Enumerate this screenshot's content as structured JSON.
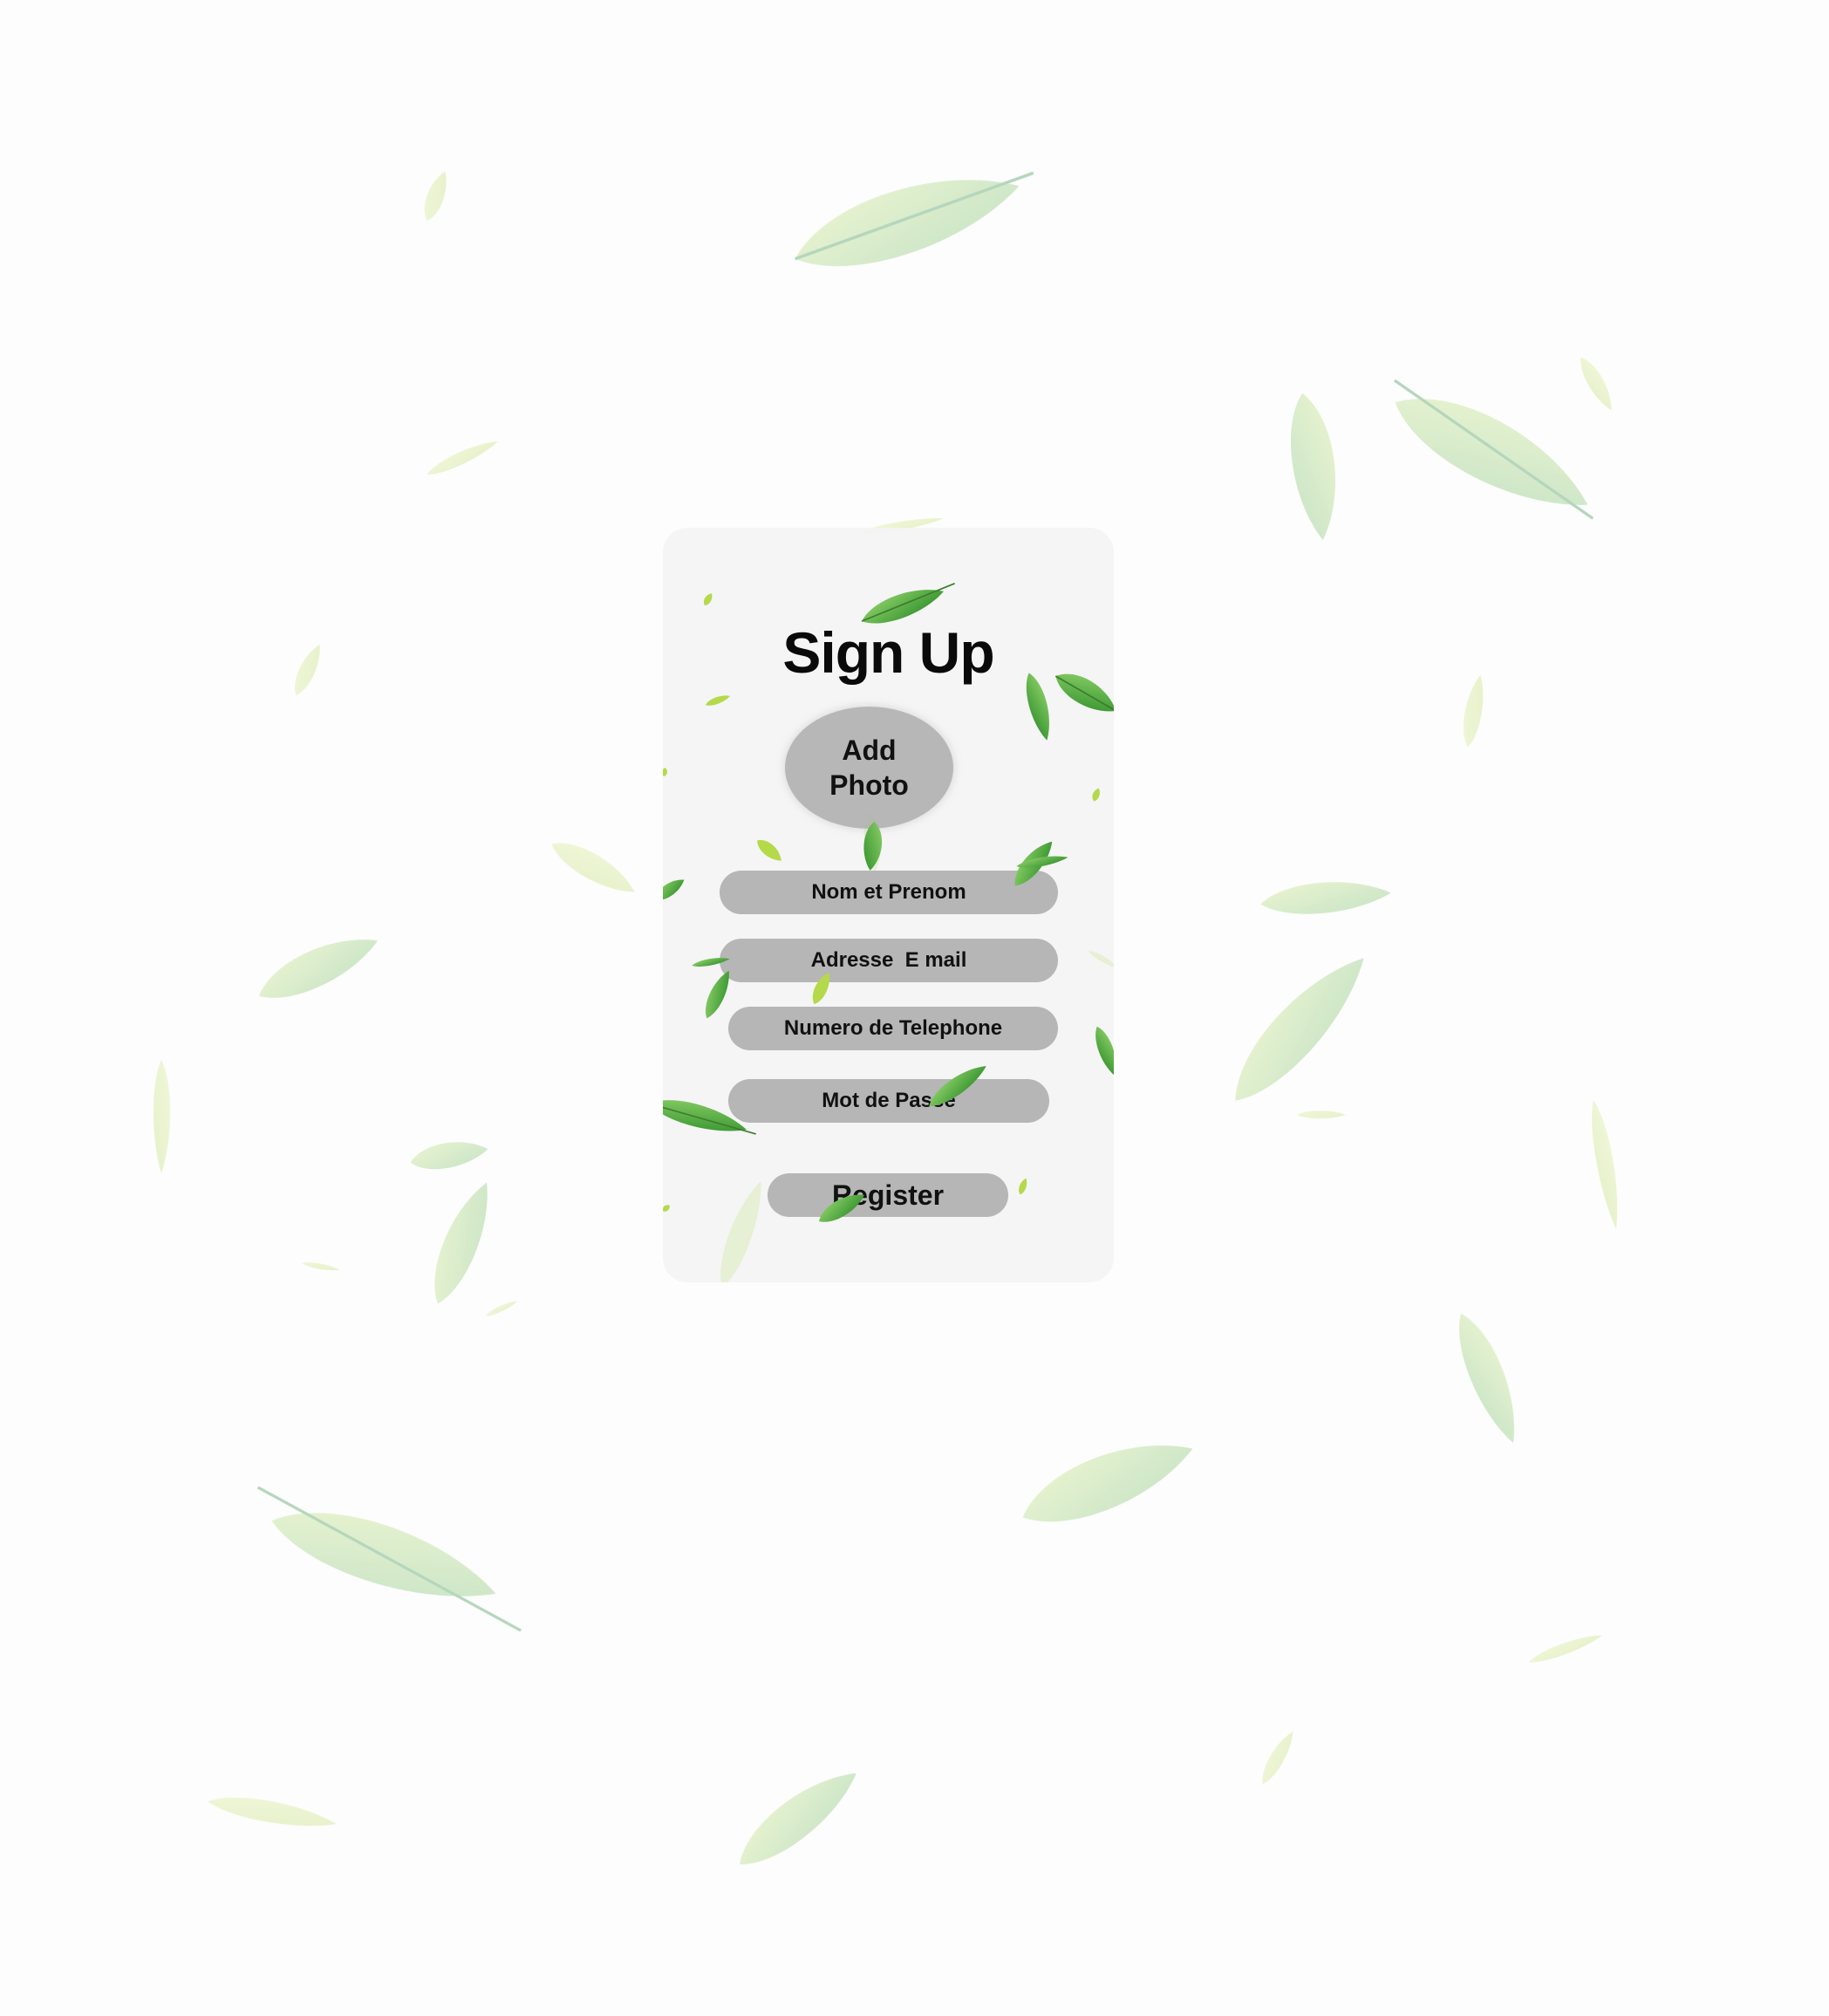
{
  "signup": {
    "title": "Sign Up",
    "add_photo_label": "Add\nPhoto",
    "fields": {
      "name_placeholder": "Nom et Prenom",
      "email_placeholder": "Adresse  E mail",
      "phone_placeholder": "Numero de Telephone",
      "password_placeholder": "Mot de Passe"
    },
    "register_label": "Register"
  },
  "background": {
    "decoration": "falling-leaves",
    "leaf_color_light": "#cfe8c4",
    "leaf_color_dark": "#4aa332"
  }
}
